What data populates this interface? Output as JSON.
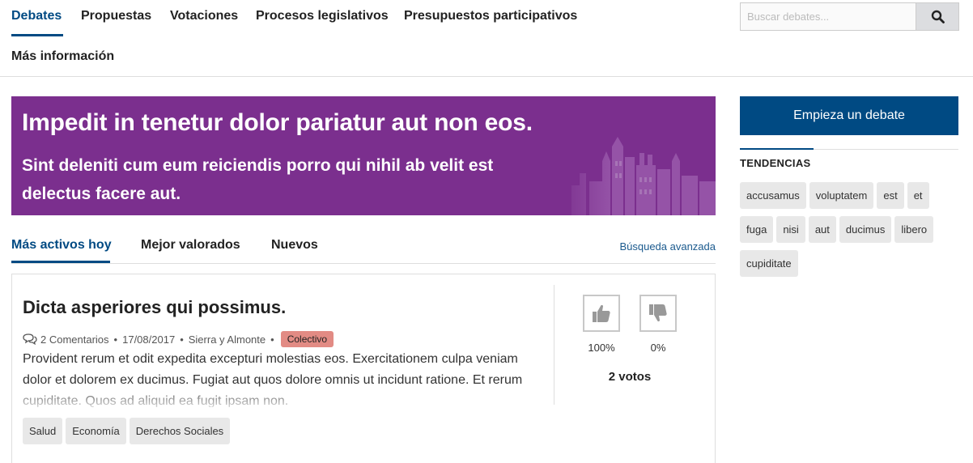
{
  "nav": {
    "items": [
      {
        "label": "Debates"
      },
      {
        "label": "Propuestas"
      },
      {
        "label": "Votaciones"
      },
      {
        "label": "Procesos legislativos"
      },
      {
        "label": "Presupuestos participativos"
      },
      {
        "label": "Más información"
      }
    ],
    "active": "Debates"
  },
  "search": {
    "placeholder": "Buscar debates...",
    "icon": "search-icon"
  },
  "banner": {
    "title": "Impedit in tenetur dolor pariatur aut non eos.",
    "description": "Sint deleniti cum eum reiciendis porro qui nihil ab velit est delectus facere aut.",
    "color": "#7b2f8e"
  },
  "tabs": {
    "items": [
      {
        "label": "Más activos hoy"
      },
      {
        "label": "Mejor valorados"
      },
      {
        "label": "Nuevos"
      }
    ],
    "active": "Más activos hoy",
    "advanced_search": "Búsqueda avanzada"
  },
  "debate": {
    "title": "Dicta asperiores qui possimus.",
    "comments": "2 Comentarios",
    "date": "17/08/2017",
    "author": "Sierra y Almonte",
    "badge": "Colectivo",
    "text": "Provident rerum et odit expedita excepturi molestias eos. Exercitationem culpa veniam dolor et dolorem ex ducimus. Fugiat aut quos dolore omnis ut incidunt ratione. Et rerum cupiditate. Quos ad aliquid ea fugit ipsam non.",
    "tags": [
      "Salud",
      "Economía",
      "Derechos Sociales"
    ],
    "votes": {
      "in_favor_pct": "100%",
      "against_pct": "0%",
      "total": "2 votos"
    }
  },
  "sidebar": {
    "start_button": "Empieza un debate",
    "trends_title": "TENDENCIAS",
    "trends": [
      "accusamus",
      "voluptatem",
      "est",
      "et",
      "fuga",
      "nisi",
      "aut",
      "ducimus",
      "libero",
      "cupiditate"
    ]
  },
  "colors": {
    "primary": "#004a83",
    "badge": "#e28b84",
    "tag_bg": "#e8e8e8"
  }
}
